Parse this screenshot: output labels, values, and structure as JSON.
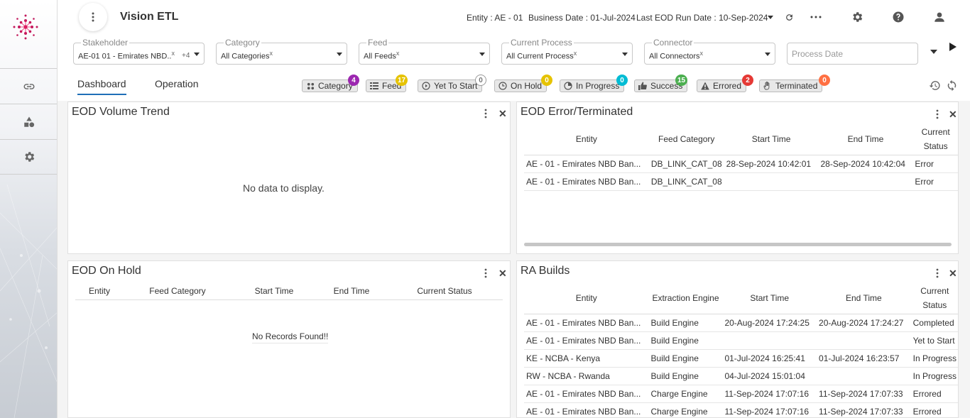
{
  "app": {
    "title": "Vision ETL"
  },
  "header": {
    "entity_label": "Entity :",
    "entity_value": "AE - 01",
    "business_date_label": "Business Date :",
    "business_date_value": "01-Jul-2024",
    "last_eod_label": "Last EOD Run Date :",
    "last_eod_value": "10-Sep-2024"
  },
  "filters": {
    "stakeholder": {
      "label": "Stakeholder",
      "value": "AE-01 01 - Emirates NBD..",
      "clear": "x",
      "extra": "+4"
    },
    "category": {
      "label": "Category",
      "value": "All Categories",
      "clear": "x"
    },
    "feed": {
      "label": "Feed",
      "value": "All Feeds",
      "clear": "x"
    },
    "current_process": {
      "label": "Current Process",
      "value": "All Current Process",
      "clear": "x"
    },
    "connector": {
      "label": "Connector",
      "value": "All Connectors",
      "clear": "x"
    },
    "process_date": {
      "placeholder": "Process Date"
    }
  },
  "tabs": [
    {
      "label": "Dashboard",
      "active": true
    },
    {
      "label": "Operation",
      "active": false
    }
  ],
  "chips": [
    {
      "label": "Category",
      "count": "4",
      "color": "#9c27b0"
    },
    {
      "label": "Feed",
      "count": "17",
      "color": "#e6c300"
    },
    {
      "label": "Yet To Start",
      "count": "0",
      "color": "#ffffff"
    },
    {
      "label": "On Hold",
      "count": "0",
      "color": "#e6c300"
    },
    {
      "label": "In Progress",
      "count": "0",
      "color": "#00bcd4"
    },
    {
      "label": "Success",
      "count": "15",
      "color": "#4caf50"
    },
    {
      "label": "Errored",
      "count": "2",
      "color": "#e53935"
    },
    {
      "label": "Terminated",
      "count": "0",
      "color": "#ff7043"
    }
  ],
  "panels": {
    "volume": {
      "title": "EOD Volume Trend",
      "empty": "No data to display."
    },
    "error": {
      "title": "EOD Error/Terminated",
      "columns": [
        "Entity",
        "Feed Category",
        "Start Time",
        "End Time",
        "Current Status"
      ],
      "rows": [
        [
          "AE - 01 - Emirates NBD Ban...",
          "DB_LINK_CAT_08",
          "28-Sep-2024 10:42:01",
          "28-Sep-2024 10:42:04",
          "Error"
        ],
        [
          "AE - 01 - Emirates NBD Ban...",
          "DB_LINK_CAT_08",
          "",
          "",
          "Error"
        ]
      ]
    },
    "hold": {
      "title": "EOD On Hold",
      "columns": [
        "Entity",
        "Feed Category",
        "Start Time",
        "End Time",
        "Current Status"
      ],
      "empty": "No Records Found!!"
    },
    "ra": {
      "title": "RA Builds",
      "columns": [
        "Entity",
        "Extraction Engine",
        "Start Time",
        "End Time",
        "Current Status"
      ],
      "rows": [
        [
          "AE - 01 - Emirates NBD Ban...",
          "Build Engine",
          "20-Aug-2024 17:24:25",
          "20-Aug-2024 17:24:27",
          "Completed"
        ],
        [
          "AE - 01 - Emirates NBD Ban...",
          "Build Engine",
          "",
          "",
          "Yet to Start"
        ],
        [
          "KE - NCBA - Kenya",
          "Build Engine",
          "01-Jul-2024 16:25:41",
          "01-Jul-2024 16:23:57",
          "In Progress"
        ],
        [
          "RW - NCBA - Rwanda",
          "Build Engine",
          "04-Jul-2024 15:01:04",
          "",
          "In Progress"
        ],
        [
          "AE - 01 - Emirates NBD Ban...",
          "Charge Engine",
          "11-Sep-2024 17:07:16",
          "11-Sep-2024 17:07:33",
          "Errored"
        ],
        [
          "AE - 01 - Emirates NBD Ban...",
          "Charge Engine",
          "11-Sep-2024 17:07:16",
          "11-Sep-2024 17:07:33",
          "Errored"
        ]
      ]
    }
  }
}
